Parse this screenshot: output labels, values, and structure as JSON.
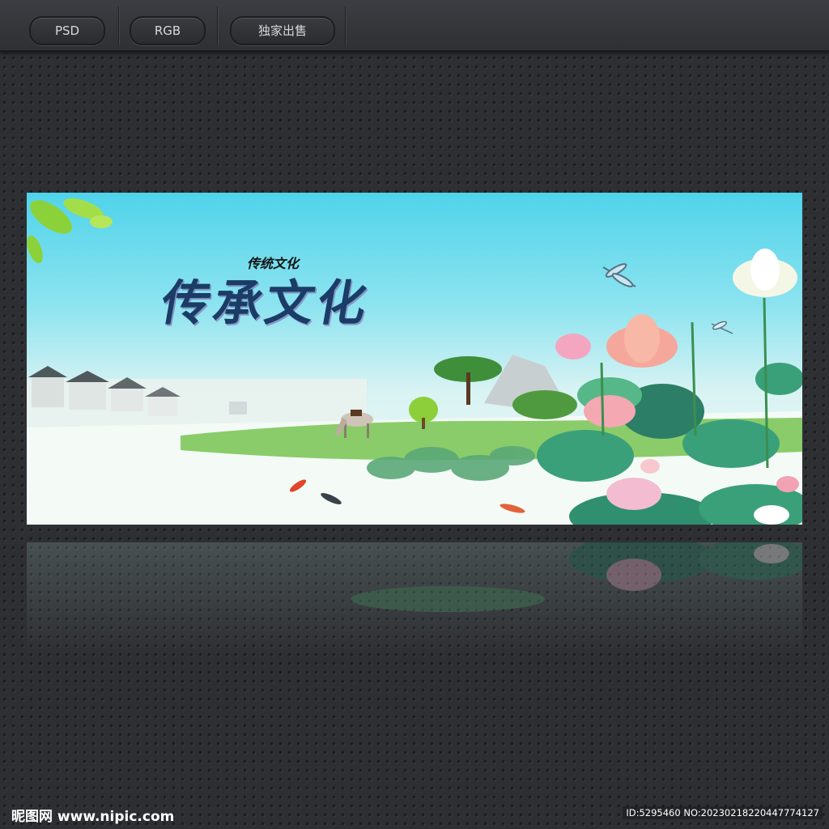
{
  "toolbar": {
    "tags": [
      {
        "label": "PSD"
      },
      {
        "label": "RGB"
      },
      {
        "label": "独家出售"
      }
    ]
  },
  "poster": {
    "title": "传承文化",
    "subtitle": "传统文化"
  },
  "watermark": {
    "logo": "昵图网 www.nipic.com",
    "id": "ID:5295460 NO:20230218220447774127"
  },
  "colors": {
    "background": "#2e2f33",
    "sky_top": "#4fd3ea",
    "lotus_pink": "#f2a3b3",
    "leaf_green": "#2f8f6f",
    "title_blue": "#1a3c66"
  }
}
